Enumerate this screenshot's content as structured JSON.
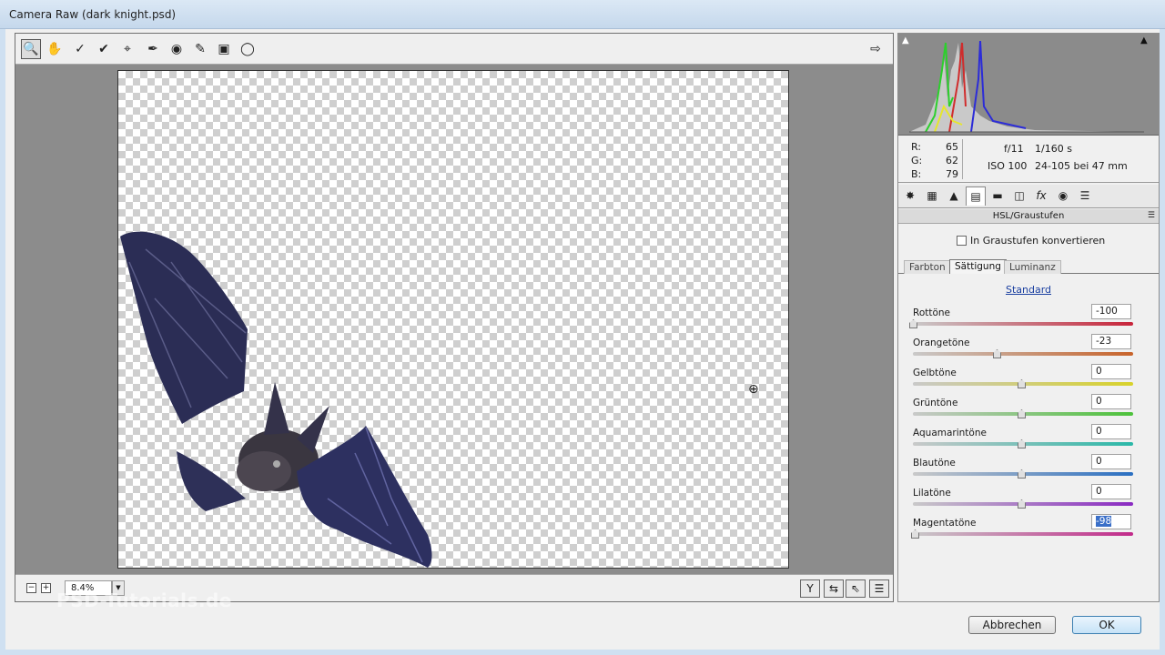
{
  "window": {
    "title": "Camera Raw (dark knight.psd)"
  },
  "toolbar": {
    "tools": [
      "zoom-tool",
      "hand-tool",
      "white-balance-tool",
      "color-sampler-tool",
      "targeted-adjustment-tool",
      "crop-tool",
      "red-eye-tool",
      "adjustment-brush-tool",
      "graduated-filter-tool",
      "radial-filter-tool"
    ],
    "export_icon": "open-preferences-icon"
  },
  "status": {
    "zoom": "8.4%"
  },
  "watermark": "PSD-Tutorials.de",
  "info": {
    "r_label": "R:",
    "r": "65",
    "g_label": "G:",
    "g": "62",
    "b_label": "B:",
    "b": "79",
    "aperture": "f/11",
    "shutter": "1/160 s",
    "iso": "ISO 100",
    "lens": "24-105 bei 47 mm"
  },
  "panel": {
    "title": "HSL/Graustufen",
    "grayscale_label": "In Graustufen konvertieren",
    "tabs": [
      "Farbton",
      "Sättigung",
      "Luminanz"
    ],
    "active_tab": "Sättigung",
    "default_link": "Standard",
    "sliders": [
      {
        "label": "Rottöne",
        "value": "-100",
        "num": -100,
        "color": "#c8243a"
      },
      {
        "label": "Orangetöne",
        "value": "-23",
        "num": -23,
        "color": "#c8632a"
      },
      {
        "label": "Gelbtöne",
        "value": "0",
        "num": 0,
        "color": "#d8d22a"
      },
      {
        "label": "Grüntöne",
        "value": "0",
        "num": 0,
        "color": "#4cc23a"
      },
      {
        "label": "Aquamarintöne",
        "value": "0",
        "num": 0,
        "color": "#2ab8a8"
      },
      {
        "label": "Blautöne",
        "value": "0",
        "num": 0,
        "color": "#2a6fc2"
      },
      {
        "label": "Lilatöne",
        "value": "0",
        "num": 0,
        "color": "#8a2ac2"
      },
      {
        "label": "Magentatöne",
        "value": "-98",
        "num": -98,
        "color": "#c22a8a"
      }
    ]
  },
  "buttons": {
    "cancel": "Abbrechen",
    "ok": "OK"
  }
}
